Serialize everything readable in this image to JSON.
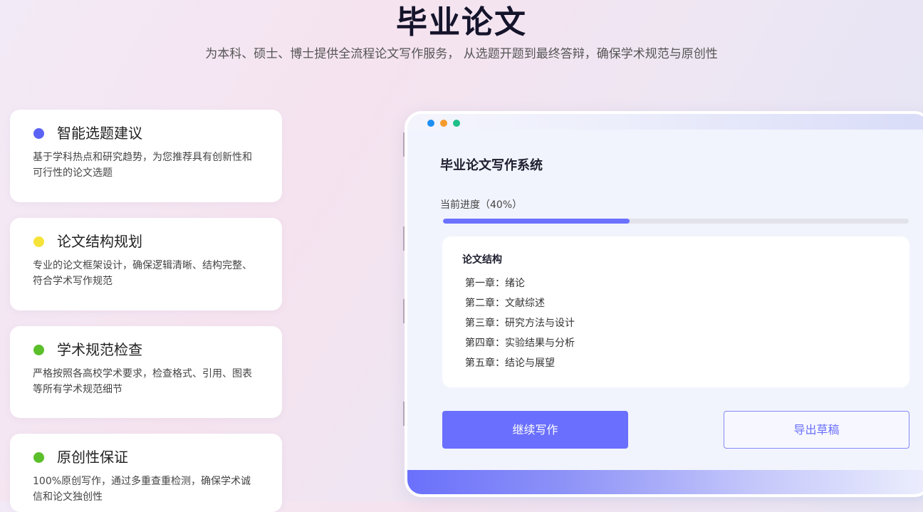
{
  "hero": {
    "title": "毕业论文",
    "subtitle": "为本科、硕士、博士提供全流程论文写作服务， 从选题开题到最终答辩，确保学术规范与原创性"
  },
  "features": [
    {
      "title": "智能选题建议",
      "desc": "基于学科热点和研究趋势，为您推荐具有创新性和可行性的论文选题",
      "dot_color": "#5b63f5"
    },
    {
      "title": "论文结构规划",
      "desc": "专业的论文框架设计，确保逻辑清晰、结构完整、符合学术写作规范",
      "dot_color": "#f6e33a"
    },
    {
      "title": "学术规范检查",
      "desc": "严格按照各高校学术要求，检查格式、引用、图表等所有学术规范细节",
      "dot_color": "#5bbf2b"
    },
    {
      "title": "原创性保证",
      "desc": "100%原创写作，通过多重查重检测，确保学术诚信和论文独创性",
      "dot_color": "#5bbf2b"
    }
  ],
  "window": {
    "dots": [
      "#1e8ff0",
      "#f59b2c",
      "#1fbf8a"
    ],
    "title": "毕业论文写作系统",
    "progress_label": "当前进度（40%）",
    "progress": 0.4,
    "outline": {
      "heading": "论文结构",
      "chapters": [
        "第一章：绪论",
        "第二章：文献综述",
        "第三章：研究方法与设计",
        "第四章：实验结果与分析",
        "第五章：结论与展望"
      ]
    },
    "continue_label": "继续写作",
    "export_label": "导出草稿"
  }
}
